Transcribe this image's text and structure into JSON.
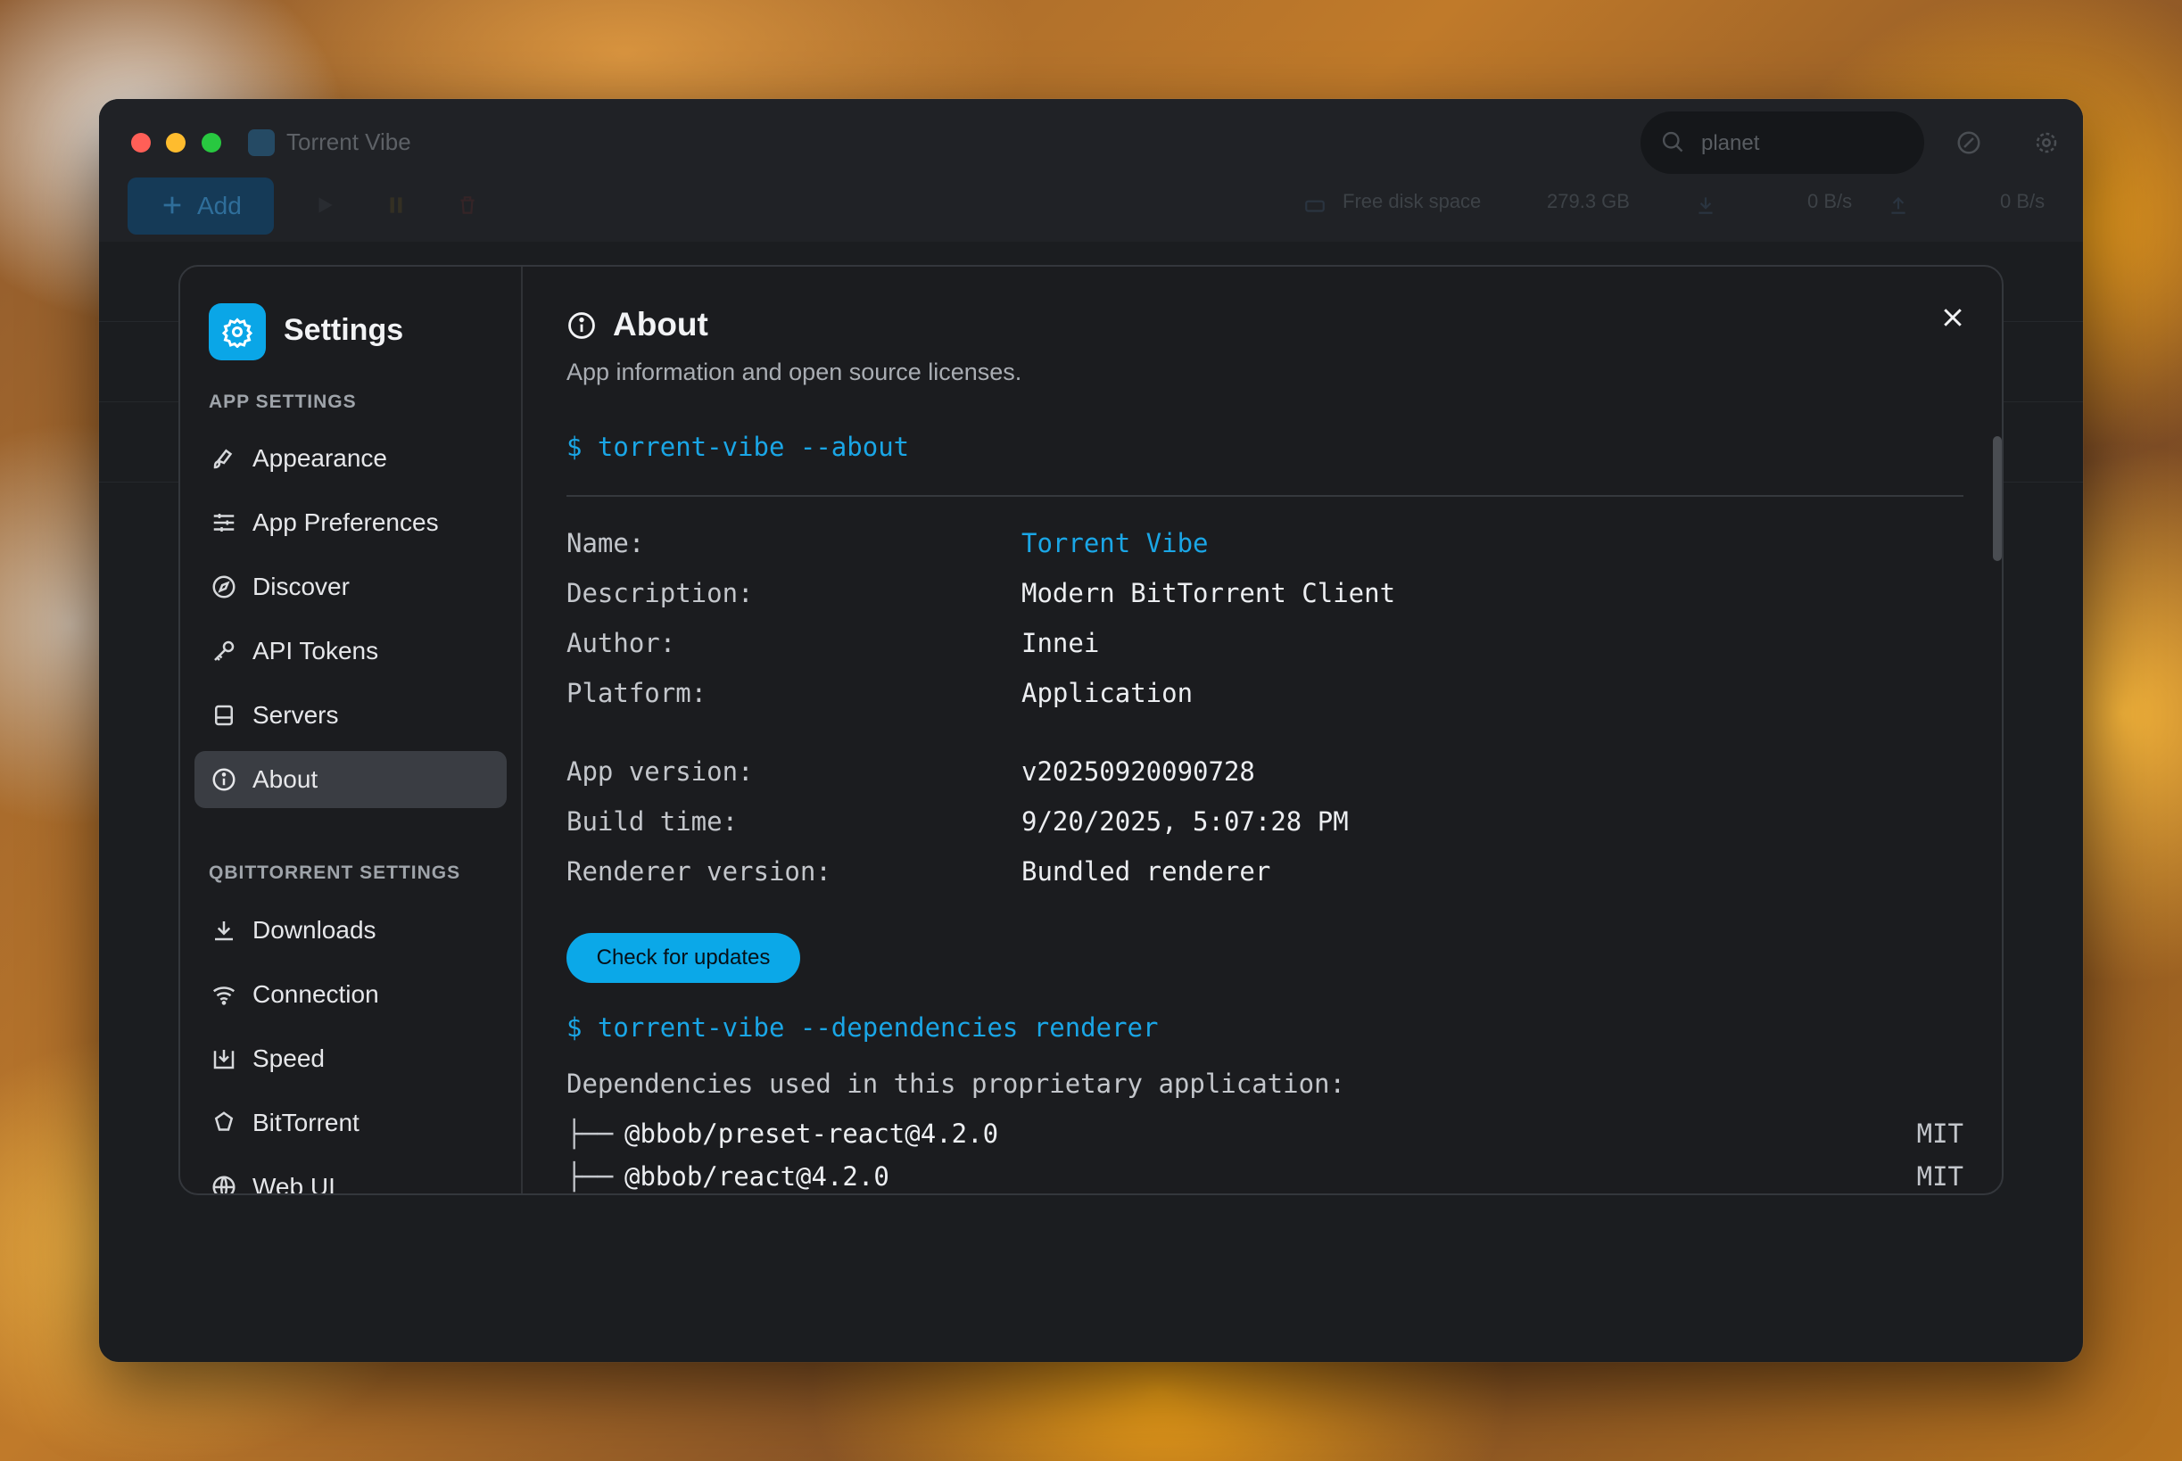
{
  "window": {
    "app_title": "Torrent Vibe",
    "search_value": "planet",
    "toolbar": {
      "add_label": "Add",
      "free_disk_label": "Free disk space",
      "free_disk_value": "279.3 GB",
      "download_speed": "0 B/s",
      "upload_speed": "0 B/s"
    }
  },
  "settings": {
    "title": "Settings",
    "sections": [
      {
        "heading": "APP SETTINGS",
        "items": [
          {
            "label": "Appearance",
            "icon": "brush-icon"
          },
          {
            "label": "App Preferences",
            "icon": "sliders-icon"
          },
          {
            "label": "Discover",
            "icon": "compass-icon"
          },
          {
            "label": "API Tokens",
            "icon": "key-icon"
          },
          {
            "label": "Servers",
            "icon": "server-icon"
          },
          {
            "label": "About",
            "icon": "info-icon",
            "active": true
          }
        ]
      },
      {
        "heading": "QBITTORRENT SETTINGS",
        "items": [
          {
            "label": "Downloads",
            "icon": "download-icon"
          },
          {
            "label": "Connection",
            "icon": "wifi-icon"
          },
          {
            "label": "Speed",
            "icon": "speed-icon"
          },
          {
            "label": "BitTorrent",
            "icon": "gear-outline-icon"
          },
          {
            "label": "Web UI",
            "icon": "globe-icon"
          }
        ]
      }
    ]
  },
  "about": {
    "title": "About",
    "subtitle": "App information and open source licenses.",
    "command_about": "$ torrent-vibe --about",
    "fields": [
      {
        "key": "Name:",
        "value": "Torrent Vibe"
      },
      {
        "key": "Description:",
        "value": "Modern BitTorrent Client"
      },
      {
        "key": "Author:",
        "value": "Innei"
      },
      {
        "key": "Platform:",
        "value": "Application"
      },
      {
        "key": "App version:",
        "value": "v20250920090728"
      },
      {
        "key": "Build time:",
        "value": "9/20/2025, 5:07:28 PM"
      },
      {
        "key": "Renderer version:",
        "value": "Bundled renderer"
      }
    ],
    "check_updates_label": "Check for updates",
    "command_deps": "$ torrent-vibe --dependencies renderer",
    "deps_intro": "Dependencies used in this proprietary application:",
    "deps": [
      {
        "tree": "├──",
        "name": "@bbob/preset-react@4.2.0",
        "license": "MIT"
      },
      {
        "tree": "├──",
        "name": "@bbob/react@4.2.0",
        "license": "MIT"
      }
    ]
  },
  "colors": {
    "accent": "#0ba8e8",
    "window_bg": "#1b1d20",
    "dialog_bg": "#1b1c1f",
    "active_item_bg": "#3a3d43"
  }
}
